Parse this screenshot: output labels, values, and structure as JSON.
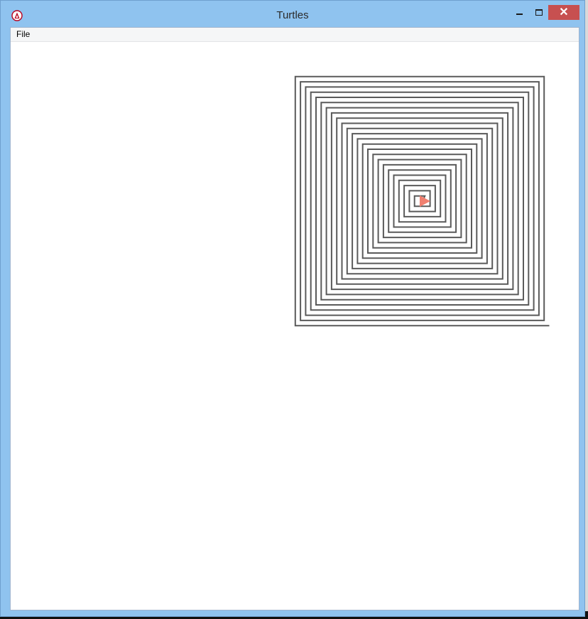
{
  "window": {
    "title": "Turtles",
    "close_label": "✕"
  },
  "menu": {
    "file_label": "File"
  },
  "canvas": {
    "line_color": "#5a5a5a",
    "turtle_color": "#f08070",
    "spiral_square_count": 24
  },
  "colors": {
    "titlebar": "#8fc3ef",
    "close_button": "#c75050"
  }
}
